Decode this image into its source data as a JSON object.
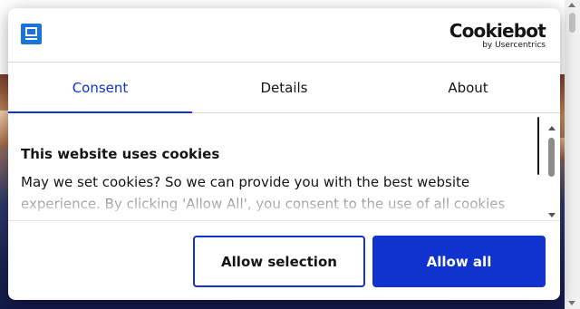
{
  "brand": {
    "logo_icon": "website-logo-icon",
    "cookiebot_name": "Cookiebot",
    "cookiebot_sub": "by Usercentrics"
  },
  "tabs": [
    {
      "label": "Consent",
      "active": true
    },
    {
      "label": "Details",
      "active": false
    },
    {
      "label": "About",
      "active": false
    }
  ],
  "content": {
    "heading": "This website uses cookies",
    "text": "May we set cookies? So we can provide you with the best website experience. By clicking 'Allow All', you consent to the use of all cookies and"
  },
  "buttons": {
    "allow_selection": "Allow selection",
    "allow_all": "Allow all"
  },
  "colors": {
    "accent": "#1032cf",
    "text": "#141414",
    "border": "#d6d6d6"
  }
}
